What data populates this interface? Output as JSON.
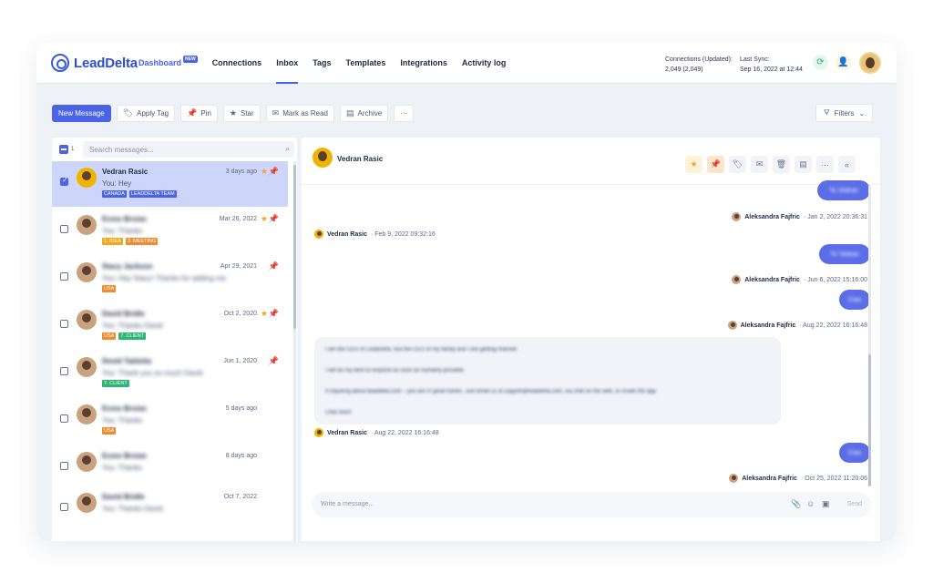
{
  "header": {
    "brand": "LeadDelta",
    "nav": [
      "Dashboard",
      "Connections",
      "Inbox",
      "Tags",
      "Templates",
      "Integrations",
      "Activity log"
    ],
    "dashboard_badge": "NEW",
    "active_nav": "Inbox",
    "connections_label": "Connections (Updated):",
    "connections_value": "2,049 (2,049)",
    "sync_label": "Last Sync:",
    "sync_value": "Sep 16, 2022 at 12:44"
  },
  "toolbar": {
    "new_message": "New Message",
    "apply_tag": "Apply Tag",
    "pin": "Pin",
    "star": "Star",
    "mark_read": "Mark as Read",
    "archive": "Archive",
    "more": "···",
    "filters": "Filters"
  },
  "list": {
    "selected_count": "1",
    "search_placeholder": "Search messages...",
    "items": [
      {
        "name": "Vedran Rasic",
        "preview": "You: Hey",
        "date": "3 days ago",
        "tags": [
          {
            "label": "CANADA",
            "color": "#4b63e6"
          },
          {
            "label": "LEADDELTA TEAM",
            "color": "#4b63e6"
          }
        ]
      },
      {
        "name": "Ecmo Brsian",
        "preview": "You: Thanks",
        "date": "Mar 26, 2022",
        "tags": [
          {
            "label": "1. IDEA",
            "color": "#f1a81c"
          },
          {
            "label": "3. MEETING",
            "color": "#f08c2d"
          }
        ]
      },
      {
        "name": "Stacy Jackson",
        "preview": "You: Hey Stacy! Thanks for adding me",
        "date": "Apr 29, 2021",
        "tags": [
          {
            "label": "USA",
            "color": "#f08c2d"
          }
        ]
      },
      {
        "name": "David Bridle",
        "preview": "You: Thanks David",
        "date": "Oct 2, 2020",
        "tags": [
          {
            "label": "USA",
            "color": "#f08c2d"
          },
          {
            "label": "7. CLIENT",
            "color": "#2bb673"
          }
        ]
      },
      {
        "name": "Devid Tabletta",
        "preview": "You: Thank you so much David",
        "date": "Jun 1, 2020",
        "tags": [
          {
            "label": "7. CLIENT",
            "color": "#2bb673"
          }
        ]
      },
      {
        "name": "Ecmo Brsian",
        "preview": "You: Thanks",
        "date": "5 days ago",
        "tags": [
          {
            "label": "USA",
            "color": "#f08c2d"
          }
        ]
      },
      {
        "name": "Ecmo Brsian",
        "preview": "You: Thanks",
        "date": "8 days ago",
        "tags": []
      },
      {
        "name": "David Bridle",
        "preview": "You: Thanks David",
        "date": "Oct 7, 2022",
        "tags": []
      }
    ]
  },
  "chat": {
    "contact": "Vedran Rasic",
    "messages": [
      {
        "text": "To Vedran",
        "sender": "Aleksandra Fajfric",
        "time": "· Jan 2, 2022 20:36:31"
      },
      {
        "sender": "Vedran Rasic",
        "time": "· Feb 9, 2022 09:32:16"
      },
      {
        "text": "To Vedran",
        "sender": "Aleksandra Fajfric",
        "time": "· Jun 6, 2022 15:16:00"
      },
      {
        "text": "Ciao",
        "sender": "Aleksandra Fajfric",
        "time": "· Aug 22, 2022 16:16:48"
      },
      {
        "sender": "Vedran Rasic",
        "time": "· Aug 22, 2022 16:16:48"
      },
      {
        "text": "Ciao",
        "sender": "Aleksandra Fajfric",
        "time": "· Oct 25, 2022 11:20:06"
      }
    ],
    "long_message": [
      "I am the CEO of LeadDelta. But the CEO of my family and I are getting married.",
      "I will do my best to respond as soon as humanly possible.",
      "If inquiring about leaddelta.com – you are in great hands. Just email us at support@leaddelta.com, via chat on the web, or inside the app.",
      "Chat soon!"
    ],
    "compose_placeholder": "Write a message...",
    "send": "Send"
  }
}
